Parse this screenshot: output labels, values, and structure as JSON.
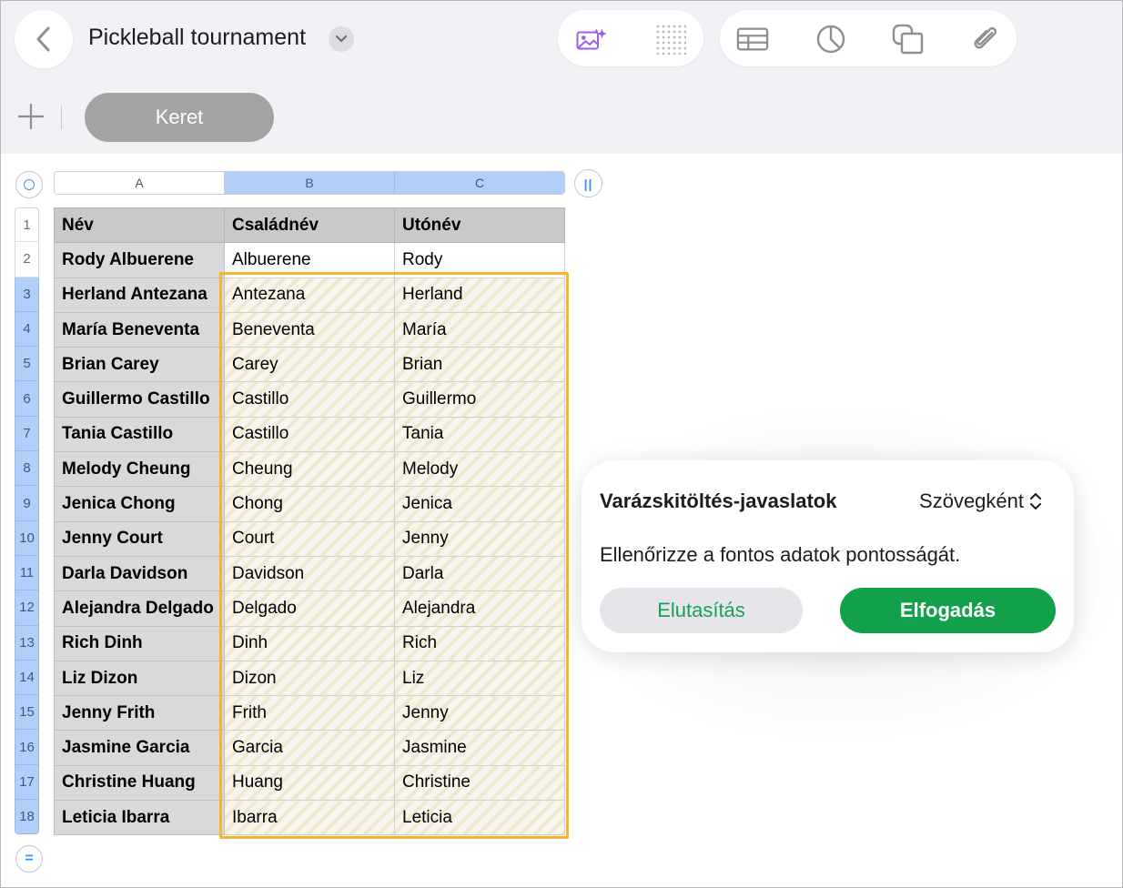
{
  "header": {
    "title": "Pickleball tournament",
    "icons": [
      "back-chevron-icon",
      "title-dropdown-chevron-icon",
      "magic-image-icon",
      "dot-grid-icon",
      "table-icon",
      "chart-icon",
      "shapes-icon",
      "paperclip-icon"
    ]
  },
  "toolbar": {
    "add_icon": "plus-icon",
    "frame_button_label": "Keret"
  },
  "columns": [
    "A",
    "B",
    "C"
  ],
  "selected_columns": [
    "B",
    "C"
  ],
  "rows": [
    "1",
    "2",
    "3",
    "4",
    "5",
    "6",
    "7",
    "8",
    "9",
    "10",
    "11",
    "12",
    "13",
    "14",
    "15",
    "16",
    "17",
    "18"
  ],
  "selected_rows_from": 3,
  "table": {
    "headers": [
      "Név",
      "Családnév",
      "Utónév"
    ],
    "data": [
      [
        "Rody Albuerene",
        "Albuerene",
        "Rody"
      ],
      [
        "Herland Antezana",
        "Antezana",
        "Herland"
      ],
      [
        "María Beneventa",
        "Beneventa",
        "María"
      ],
      [
        "Brian Carey",
        "Carey",
        "Brian"
      ],
      [
        "Guillermo Castillo",
        "Castillo",
        "Guillermo"
      ],
      [
        "Tania Castillo",
        "Castillo",
        "Tania"
      ],
      [
        "Melody Cheung",
        "Cheung",
        "Melody"
      ],
      [
        "Jenica Chong",
        "Chong",
        "Jenica"
      ],
      [
        "Jenny Court",
        "Court",
        "Jenny"
      ],
      [
        "Darla Davidson",
        "Davidson",
        "Darla"
      ],
      [
        "Alejandra Delgado",
        "Delgado",
        "Alejandra"
      ],
      [
        "Rich Dinh",
        "Dinh",
        "Rich"
      ],
      [
        "Liz Dizon",
        "Dizon",
        "Liz"
      ],
      [
        "Jenny Frith",
        "Frith",
        "Jenny"
      ],
      [
        "Jasmine Garcia",
        "Garcia",
        "Jasmine"
      ],
      [
        "Christine Huang",
        "Huang",
        "Christine"
      ],
      [
        "Leticia Ibarra",
        "Ibarra",
        "Leticia"
      ]
    ]
  },
  "popover": {
    "title": "Varázskitöltés-javaslatok",
    "mode": "Szövegként",
    "message": "Ellenőrizze a fontos adatok pontosságát.",
    "reject_label": "Elutasítás",
    "accept_label": "Elfogadás"
  },
  "colors": {
    "accent_blue": "#3d8ff5",
    "selection_blue": "#b2cffa",
    "suggestion_outline": "#f7b52c",
    "accept_green": "#12a04b",
    "reject_text_green": "#18a058",
    "magic_icon_purple": "#9b5de5"
  }
}
